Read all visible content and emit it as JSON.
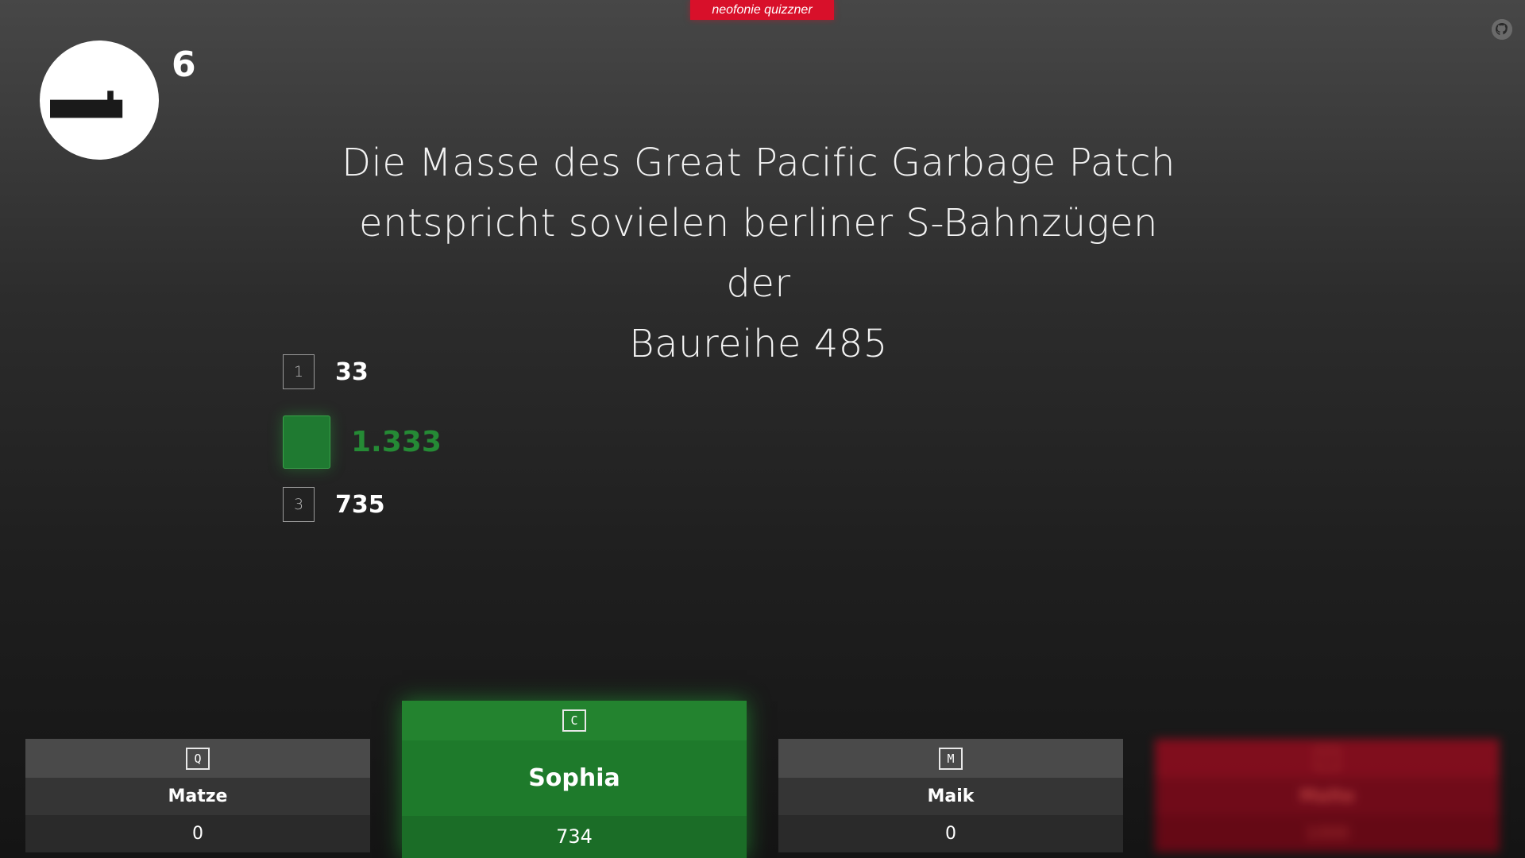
{
  "app": {
    "brand": "neofonie quizzner"
  },
  "round": {
    "number": "6"
  },
  "question": {
    "lines": [
      "Die Masse des Great Pacific Garbage Patch",
      "entspricht sovielen berliner S-Bahnzügen der",
      "Baureihe 485"
    ]
  },
  "answers": [
    {
      "key": "1",
      "value": "33"
    },
    {
      "key": "",
      "value": "1.333",
      "state": "correct"
    },
    {
      "key": "3",
      "value": "735"
    }
  ],
  "players": [
    {
      "key": "Q",
      "name": "Matze",
      "score": "0"
    },
    {
      "key": "C",
      "name": "Sophia",
      "score": "734",
      "state": "active"
    },
    {
      "key": "M",
      "name": "Maik",
      "score": "0"
    },
    {
      "key": "P",
      "name": "Malte",
      "score": "1000",
      "state": "blurred"
    }
  ],
  "colors": {
    "brand": "#d8102a",
    "correct": "#258a35",
    "active": "#1e7a2b"
  },
  "icons": {
    "timer": "hourglass-icon",
    "source": "github-icon"
  }
}
